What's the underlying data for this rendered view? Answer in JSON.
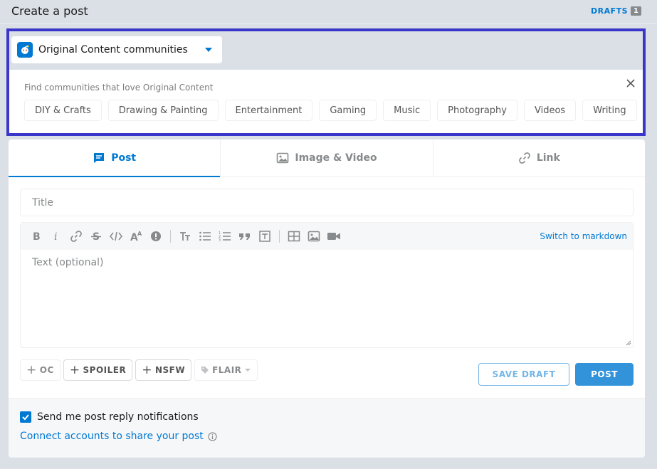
{
  "header": {
    "title": "Create a post",
    "drafts_label": "DRAFTS",
    "drafts_count": "1"
  },
  "community_selector": {
    "name": "Original Content communities"
  },
  "oc_panel": {
    "heading": "Find communities that love Original Content",
    "tags": [
      "DIY & Crafts",
      "Drawing & Painting",
      "Entertainment",
      "Gaming",
      "Music",
      "Photography",
      "Videos",
      "Writing"
    ]
  },
  "tabs": [
    {
      "label": "Post",
      "icon": "post-icon",
      "active": true
    },
    {
      "label": "Image & Video",
      "icon": "image-icon",
      "active": false
    },
    {
      "label": "Link",
      "icon": "link-icon",
      "active": false
    }
  ],
  "title_input": {
    "placeholder": "Title",
    "value": ""
  },
  "editor": {
    "placeholder": "Text (optional)",
    "switch_label": "Switch to markdown",
    "toolbar_icons": [
      "bold-icon",
      "italic-icon",
      "link-icon",
      "strikethrough-icon",
      "inline-code-icon",
      "superscript-icon",
      "spoiler-icon",
      "heading-icon",
      "bulleted-list-icon",
      "numbered-list-icon",
      "quote-block-icon",
      "code-block-icon",
      "table-icon",
      "image-icon",
      "video-icon"
    ]
  },
  "flags": [
    {
      "label": "OC",
      "enabled": false
    },
    {
      "label": "SPOILER",
      "enabled": true
    },
    {
      "label": "NSFW",
      "enabled": true
    },
    {
      "label": "FLAIR",
      "enabled": false
    }
  ],
  "actions": {
    "save_draft": "SAVE DRAFT",
    "post": "POST"
  },
  "footer": {
    "notify_label": "Send me post reply notifications",
    "notify_checked": true,
    "connect_label": "Connect accounts to share your post"
  },
  "colors": {
    "accent": "#0079d3",
    "background": "#dae0e6",
    "highlight_border": "#3a36c9"
  }
}
